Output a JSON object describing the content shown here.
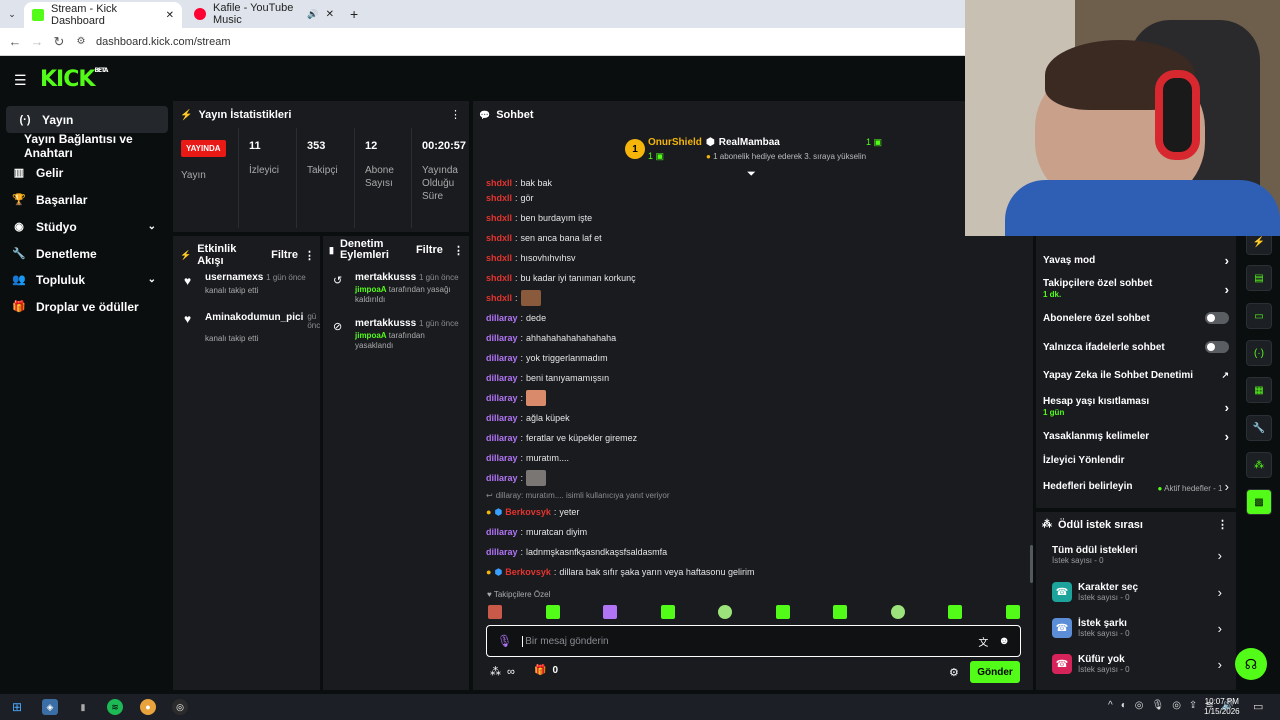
{
  "browser": {
    "tab1_title": "Stream - Kick Dashboard",
    "tab2_title": "Kafile - YouTube Music",
    "new_tab": "+",
    "url": "dashboard.kick.com/stream"
  },
  "logo": {
    "text": "KICK",
    "beta": "BETA"
  },
  "sidebar": {
    "items": [
      {
        "label": "Yayın",
        "icon": "broadcast-icon"
      },
      {
        "label": "Yayın Bağlantısı ve Anahtarı",
        "icon": ""
      },
      {
        "label": "Gelir",
        "icon": "chart-icon"
      },
      {
        "label": "Başarılar",
        "icon": "trophy-icon"
      },
      {
        "label": "Stüdyo",
        "icon": "studio-icon"
      },
      {
        "label": "Denetleme",
        "icon": "wrench-icon"
      },
      {
        "label": "Topluluk",
        "icon": "people-icon"
      },
      {
        "label": "Droplar ve ödüller",
        "icon": "gift-icon"
      }
    ]
  },
  "stats": {
    "title": "Yayın İstatistikleri",
    "live_badge": "YAYINDA",
    "live_label": "Yayın",
    "viewers_val": "11",
    "viewers_lbl": "İzleyici",
    "followers_val": "353",
    "followers_lbl": "Takipçi",
    "subs_val": "12",
    "subs_lbl": "Abone Sayısı",
    "uptime_val": "00:20:57",
    "uptime_lbl": "Yayında Olduğu Süre"
  },
  "activity": {
    "title": "Etkinlik Akışı",
    "filter": "Filtre",
    "items": [
      {
        "name": "usernamexs",
        "time": "1 gün önce",
        "sub": "kanalı takip etti"
      },
      {
        "name": "Aminakodumun_pici",
        "time": "gü önc",
        "sub": "kanalı takip etti"
      }
    ]
  },
  "modactions": {
    "title": "Denetim Eylemleri",
    "filter": "Filtre",
    "items": [
      {
        "name": "mertakkusss",
        "time": "1 gün önce",
        "actor": "jimpoaA",
        "rest": "tarafından yasağı kaldırıldı"
      },
      {
        "name": "mertakkusss",
        "time": "1 gün önce",
        "actor": "jimpoaA",
        "rest": "tarafından yasaklandı"
      }
    ]
  },
  "chat": {
    "title": "Sohbet",
    "leader1_name": "OnurShield",
    "leader1_count": "1",
    "leader2_name": "RealMambaa",
    "leader2_count": "1",
    "leader2_sub": "1 abonelik hediye ederek 3. sıraya yükselin",
    "lines": [
      {
        "user": "shdxll",
        "msg": "bak bak"
      },
      {
        "user": "shdxll",
        "msg": "gör"
      },
      {
        "user": "shdxll",
        "msg": "ben burdayım işte"
      },
      {
        "user": "shdxll",
        "msg": "sen anca bana laf et"
      },
      {
        "user": "shdxll",
        "msg": "hısovhıhvıhsv"
      },
      {
        "user": "shdxll",
        "msg": "bu kadar iyi tanıman korkunç"
      },
      {
        "user": "shdxll",
        "msg": ""
      },
      {
        "user": "dillaray",
        "msg": "dede"
      },
      {
        "user": "dillaray",
        "msg": "ahhahahahahahahaha"
      },
      {
        "user": "dillaray",
        "msg": "yok triggerlanmadım"
      },
      {
        "user": "dillaray",
        "msg": "beni tanıyamamışsın"
      },
      {
        "user": "dillaray",
        "msg": ""
      },
      {
        "user": "dillaray",
        "msg": "ağla küpek"
      },
      {
        "user": "dillaray",
        "msg": "feratlar ve küpekler giremez"
      },
      {
        "user": "dillaray",
        "msg": "muratım...."
      },
      {
        "user": "dillaray",
        "msg": ""
      }
    ],
    "reply_note": "dillaray: muratım.... isimli kullanıcıya yanıt veriyor",
    "lines2": [
      {
        "user": "Berkovsyk",
        "msg": "yeter"
      },
      {
        "user": "dillaray",
        "msg": "muratcan diyim"
      },
      {
        "user": "dillaray",
        "msg": "ladnmşkasnfkşasndkaşsfsaldasmfa"
      },
      {
        "user": "Berkovsyk",
        "msg": "dillara bak sıfır şaka yarın veya haftasonu gelirim"
      }
    ],
    "followers_only": "Takipçilere Özel",
    "placeholder": "Bir mesaj gönderin",
    "points": "0",
    "send": "Gönder"
  },
  "settings": {
    "slow_mode": "Yavaş mod",
    "followers_chat": "Takipçilere özel sohbet",
    "followers_chat_sub": "1 dk.",
    "subs_chat": "Abonelere özel sohbet",
    "emotes_chat": "Yalnızca ifadelerle sohbet",
    "ai_mod": "Yapay Zeka ile Sohbet Denetimi",
    "age_limit": "Hesap yaşı kısıtlaması",
    "age_limit_sub": "1 gün",
    "banned_words": "Yasaklanmış kelimeler",
    "viewer_redirect": "İzleyici Yönlendir",
    "goals": "Hedefleri belirleyin",
    "goals_active": "Aktif hedefler - 1"
  },
  "rewards": {
    "title": "Ödül istek sırası",
    "items": [
      {
        "title": "Tüm ödül istekleri",
        "sub": "İstek sayısı - 0",
        "color": ""
      },
      {
        "title": "Karakter seç",
        "sub": "İstek sayısı - 0",
        "color": "#1ba39c"
      },
      {
        "title": "İstek şarkı",
        "sub": "İstek sayısı - 0",
        "color": "#5b8ed6"
      },
      {
        "title": "Küfür yok",
        "sub": "İstek sayısı - 0",
        "color": "#d6245b"
      }
    ]
  },
  "taskbar": {
    "time": "10:07 PM",
    "date": "1/15/2026"
  },
  "colors": {
    "accent": "#53fc18",
    "live": "#e91916",
    "panel": "#191b1f"
  }
}
